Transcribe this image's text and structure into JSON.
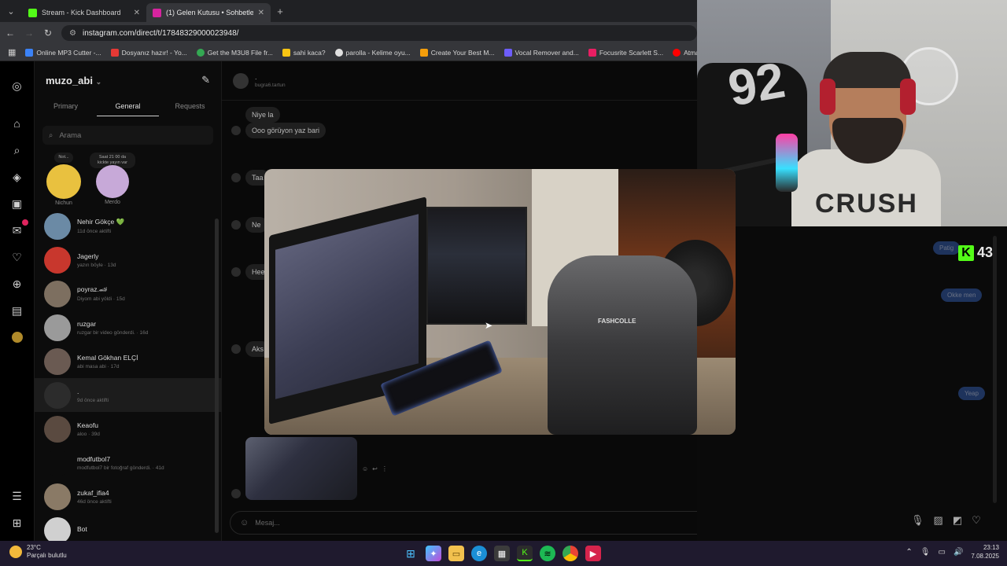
{
  "browser": {
    "tabs": [
      {
        "title": "Stream - Kick Dashboard",
        "active": false,
        "favicon_color": "#53fc18"
      },
      {
        "title": "(1) Gelen Kutusu • Sohbetler",
        "active": true,
        "favicon_color": "#d6249f"
      }
    ],
    "url": "instagram.com/direct/t/17848329000023948/",
    "bookmarks": [
      {
        "label": "Online MP3 Cutter -...",
        "color": "#3b82f6"
      },
      {
        "label": "Dosyanız hazır! - Yo...",
        "color": "#e53935"
      },
      {
        "label": "Get the M3U8 File fr...",
        "color": "#34a853"
      },
      {
        "label": "sahi kaca?",
        "color": "#f9c513"
      },
      {
        "label": "parolla - Kelime oyu...",
        "color": "#e0e0e0"
      },
      {
        "label": "Create Your Best M...",
        "color": "#f59e0b"
      },
      {
        "label": "Vocal Remover and...",
        "color": "#6d5dfc"
      },
      {
        "label": "Focusrite Scarlett S...",
        "color": "#e91e63"
      },
      {
        "label": "Atma - YouTu",
        "color": "#ff0000"
      }
    ]
  },
  "instagram": {
    "username": "muzo_abi",
    "tabs": [
      "Primary",
      "General",
      "Requests"
    ],
    "active_tab": "General",
    "search_placeholder": "Arama",
    "notes": [
      {
        "bubble": "Not...",
        "name": "Nichun",
        "color": "#e9c13f"
      },
      {
        "bubble": "Saat 21 00 da kickte yayın var",
        "name": "Merdo",
        "color": "#c7a9d8"
      }
    ],
    "conversations": [
      {
        "name": "Nehir Gökçe 💚",
        "sub": "11d önce aktifti",
        "color": "#6b8aa5"
      },
      {
        "name": "Jagerly",
        "sub": "yazın böyle · 13d",
        "color": "#c8372d"
      },
      {
        "name": "poyraz.🏎",
        "sub": "Diyom abi yöldi · 15d",
        "color": "#7d6f60"
      },
      {
        "name": "ruzgar",
        "sub": "ruzgar bir video gönderdi. · 16d",
        "color": "#9a9a9a"
      },
      {
        "name": "Kemal Gökhan ELÇİ",
        "sub": "abi masa abi · 17d",
        "color": "#6a5a52"
      },
      {
        "name": ".",
        "sub": "9d önce aktifti",
        "color": "#2c2c2c"
      },
      {
        "name": "Keaofu",
        "sub": "aloo · 39d",
        "color": "#5a4a40"
      },
      {
        "name": "modfutbol7",
        "sub": "modfutbol7 bir fotoğraf gönderdi. · 41d",
        "color": "#0c0c0c"
      },
      {
        "name": "zukaf_ifia4",
        "sub": "46d önce aktifti",
        "color": "#8a7a66"
      },
      {
        "name": "Bot",
        "sub": "",
        "color": "#d0d0d0"
      }
    ],
    "chat_header": {
      "name": ".",
      "handle": "bugra6.tartun"
    },
    "incoming": [
      "Niye la",
      "Ooo görüyon yaz bari",
      "Taa",
      "Ne",
      "Hee",
      "Aks"
    ],
    "outgoing": [
      "Patig",
      "Okke men",
      "Yeap"
    ],
    "composer_placeholder": "Mesaj..."
  },
  "overlay": {
    "kick_viewers": "43",
    "webcam_jersey_number": "92",
    "webcam_shirt_text": "CRUSH",
    "photo_chair_brand": "FASHCOLLE"
  },
  "taskbar": {
    "temperature": "23°C",
    "weather": "Parçalı bulutlu",
    "time": "23:13",
    "date": "7.08.2025"
  }
}
